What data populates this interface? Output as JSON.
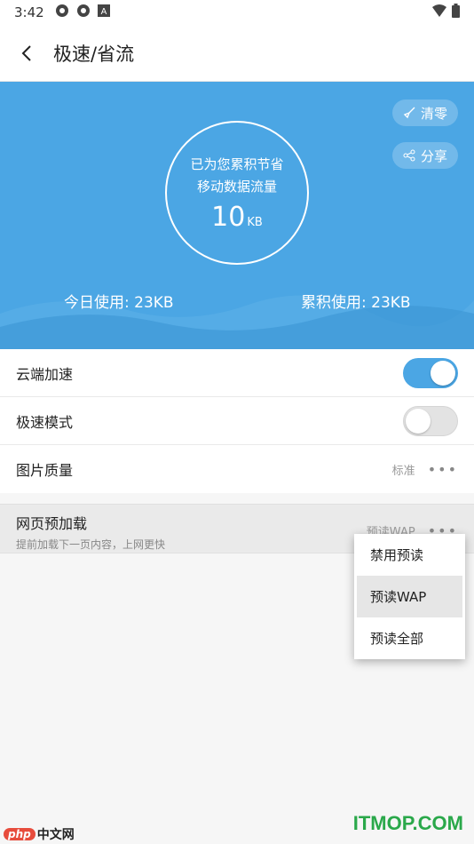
{
  "status_bar": {
    "time": "3:42",
    "icons": [
      "sync-icon",
      "sync-icon",
      "a-badge-icon"
    ],
    "right_icons": [
      "wifi-icon",
      "battery-icon"
    ]
  },
  "app_bar": {
    "title": "极速/省流"
  },
  "hero": {
    "clear_label": "清零",
    "share_label": "分享",
    "saved_line1": "已为您累积节省",
    "saved_line2": "移动数据流量",
    "saved_value": "10",
    "saved_unit": "KB",
    "today_usage": "今日使用: 23KB",
    "total_usage": "累积使用: 23KB",
    "accent": "#4ba6e4"
  },
  "settings": {
    "cloud_accel": {
      "label": "云端加速",
      "on": true
    },
    "speed_mode": {
      "label": "极速模式",
      "on": false
    },
    "image_quality": {
      "label": "图片质量",
      "value": "标准",
      "more": "•••"
    }
  },
  "preload": {
    "title": "网页预加载",
    "subtitle": "提前加载下一页内容，上网更快",
    "value": "预读WAP",
    "more": "•••"
  },
  "popup": {
    "options": [
      "禁用预读",
      "预读WAP",
      "预读全部"
    ],
    "selected_index": 1
  },
  "watermarks": {
    "left_php": "php",
    "left_text": "中文网",
    "right": "ITMOP.COM"
  }
}
